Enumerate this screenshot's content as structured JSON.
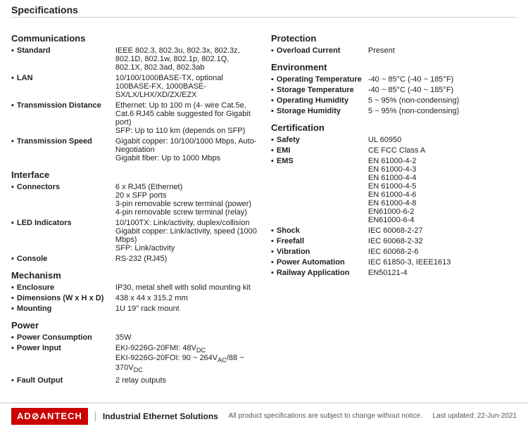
{
  "page": {
    "title": "Specifications"
  },
  "left": {
    "sections": [
      {
        "title": "Communications",
        "items": [
          {
            "label": "Standard",
            "value": "IEEE 802.3, 802.3u, 802.3x, 802.3z, 802.1D, 802.1w, 802.1p, 802.1Q, 802.1X, 802.3ad, 802.3ab"
          },
          {
            "label": "LAN",
            "value": "10/100/1000BASE-TX, optional 100BASE-FX, 1000BASE-SX/LX/LHX/XD/ZX/EZX"
          },
          {
            "label": "Transmission Distance",
            "value": "Ethernet: Up to 100 m (4- wire Cat.5e, Cat.6 RJ45 cable suggested for Gigabit port)\nSFP: Up to 110 km (depends on SFP)"
          },
          {
            "label": "Transmission Speed",
            "value": "Gigabit copper: 10/100/1000 Mbps, Auto-Negotiation\nGigabit fiber: Up to 1000 Mbps"
          }
        ]
      },
      {
        "title": "Interface",
        "items": [
          {
            "label": "Connectors",
            "value": "6 x RJ45 (Ethernet)\n20 x SFP ports\n3-pin removable screw terminal (power)\n4-pin removable screw terminal (relay)"
          },
          {
            "label": "LED Indicators",
            "value": "10/100TX: Link/activity, duplex/collision\nGigabit copper: Link/activity, speed (1000 Mbps)\nSFP: Link/activity"
          },
          {
            "label": "Console",
            "value": "RS-232 (RJ45)"
          }
        ]
      },
      {
        "title": "Mechanism",
        "items": [
          {
            "label": "Enclosure",
            "value": "IP30, metal shell with solid mounting kit"
          },
          {
            "label": "Dimensions (W x H x D)",
            "value": "438 x 44 x 315.2 mm"
          },
          {
            "label": "Mounting",
            "value": "1U 19\" rack mount"
          }
        ]
      },
      {
        "title": "Power",
        "items": [
          {
            "label": "Power Consumption",
            "value": "35W"
          },
          {
            "label": "Power Input",
            "value": "EKI-9226G-20FMI: 48VDC\nEKI-9226G-20FOI: 90 ~ 264VAC/88 ~ 370VDC"
          },
          {
            "label": "Fault Output",
            "value": "2 relay outputs"
          }
        ]
      }
    ]
  },
  "right": {
    "sections": [
      {
        "title": "Protection",
        "items": [
          {
            "label": "Overload Current",
            "value": "Present"
          }
        ]
      },
      {
        "title": "Environment",
        "items": [
          {
            "label": "Operating Temperature",
            "value": "-40 ~ 85°C (-40 ~ 185°F)"
          },
          {
            "label": "Storage Temperature",
            "value": "-40 ~ 85°C (-40 ~ 185°F)"
          },
          {
            "label": "Operating Humidity",
            "value": "5 ~ 95% (non-condensing)"
          },
          {
            "label": "Storage Humidity",
            "value": "5 ~ 95% (non-condensing)"
          }
        ]
      },
      {
        "title": "Certification",
        "items": [
          {
            "label": "Safety",
            "value": "UL 60950"
          },
          {
            "label": "EMI",
            "value": "CE FCC Class A"
          },
          {
            "label": "EMS",
            "value": "EN 61000-4-2\nEN 61000-4-3\nEN 61000-4-4\nEN 61000-4-5\nEN 61000-4-6\nEN 61000-4-8\nEN61000-6-2\nEN61000-6-4"
          },
          {
            "label": "Shock",
            "value": "IEC 60068-2-27"
          },
          {
            "label": "Freefall",
            "value": "IEC 60068-2-32"
          },
          {
            "label": "Vibration",
            "value": "IEC 60068-2-6"
          },
          {
            "label": "Power Automation",
            "value": "IEC 61850-3, IEEE1613"
          },
          {
            "label": "Railway Application",
            "value": "EN50121-4"
          }
        ]
      }
    ]
  },
  "footer": {
    "logo": "AD⧺NTECH",
    "logo_display": "AD⊘ANTECH",
    "tagline": "Industrial Ethernet Solutions",
    "note": "All product specifications are subject to change without notice.",
    "date": "Last updated: 22-Jun-2021"
  }
}
